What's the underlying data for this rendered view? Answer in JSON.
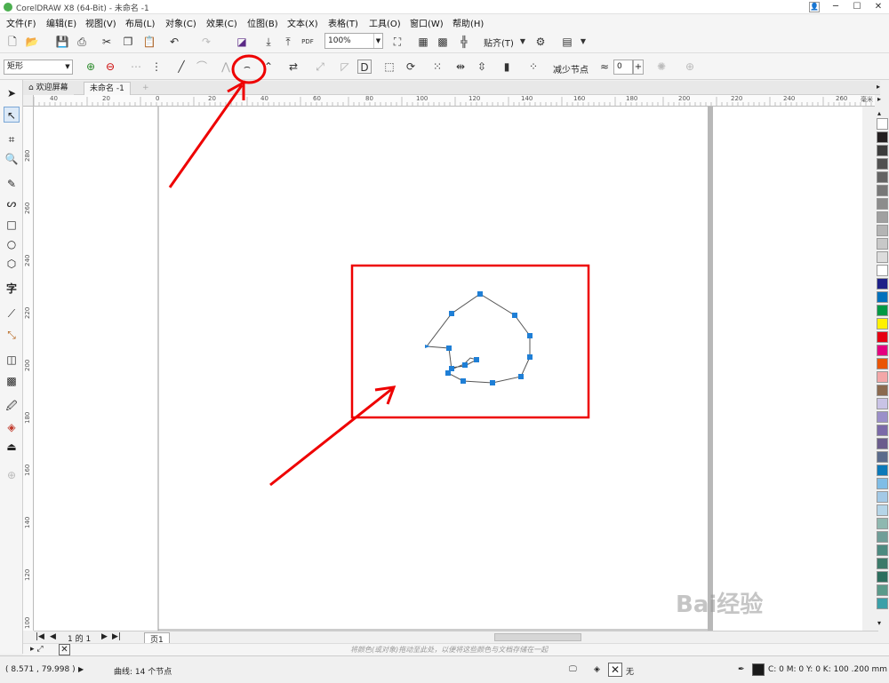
{
  "window": {
    "title": "CorelDRAW X8 (64-Bit) - 未命名 -1",
    "btn_min": "─",
    "btn_max": "☐",
    "btn_close": "✕"
  },
  "menu": [
    "文件(F)",
    "编辑(E)",
    "视图(V)",
    "布局(L)",
    "对象(C)",
    "效果(C)",
    "位图(B)",
    "文本(X)",
    "表格(T)",
    "工具(O)",
    "窗口(W)",
    "帮助(H)"
  ],
  "toolbar": {
    "zoom": "100%",
    "snap_label": "贴齐(T)",
    "pdf_label": "PDF"
  },
  "property_bar": {
    "shape_select": "矩形",
    "reduce_nodes_label": "减少节点",
    "smoothness_value": "0"
  },
  "tabs": {
    "welcome": "欢迎屏幕",
    "document": "未命名 -1",
    "add": "+"
  },
  "ruler_h_labels": [
    "40",
    "20",
    "0",
    "20",
    "40",
    "60",
    "80",
    "100",
    "120",
    "140",
    "160",
    "180",
    "200",
    "220",
    "240",
    "260"
  ],
  "ruler_v_labels": [
    "280",
    "260",
    "240",
    "220",
    "200",
    "180",
    "160",
    "140",
    "120",
    "100"
  ],
  "ruler_unit": "毫米",
  "pagenav": {
    "first": "|◀",
    "prev": "◀",
    "page_info": "1 的 1",
    "next": "▶",
    "last": "▶|",
    "page_tab": "页1"
  },
  "hint": "将颜色(或对象)拖动至此处，以便将这些颜色与文档存储在一起",
  "status": {
    "coords": "( 8.571 , 79.998 )",
    "object_info": "曲线: 14 个节点",
    "fill_none": "无",
    "outline_info": "C: 0 M: 0 Y: 0 K: 100  .200 mm"
  },
  "palette_colors": [
    "#231f20",
    "#3c3c3c",
    "#505050",
    "#646464",
    "#787878",
    "#8c8c8c",
    "#a0a0a0",
    "#b4b4b4",
    "#c8c8c8",
    "#dcdcdc",
    "#ffffff",
    "#1d2088",
    "#0071bc",
    "#009944",
    "#fff100",
    "#e60012",
    "#e4007f",
    "#ea5504",
    "#f3a7a8",
    "#8b6a4f",
    "#c9c3e6",
    "#9b8fc9",
    "#7b6aa8",
    "#6a5c8c",
    "#5a6b8c",
    "#0b79b9",
    "#7fbde6",
    "#a3c9e6",
    "#b5d5e8",
    "#8fb8b0",
    "#6f9e98",
    "#4c8a80",
    "#3b7a6a",
    "#2d6e5e",
    "#5a9a8a",
    "#3aa0a8"
  ],
  "watermark": "Bai经验"
}
